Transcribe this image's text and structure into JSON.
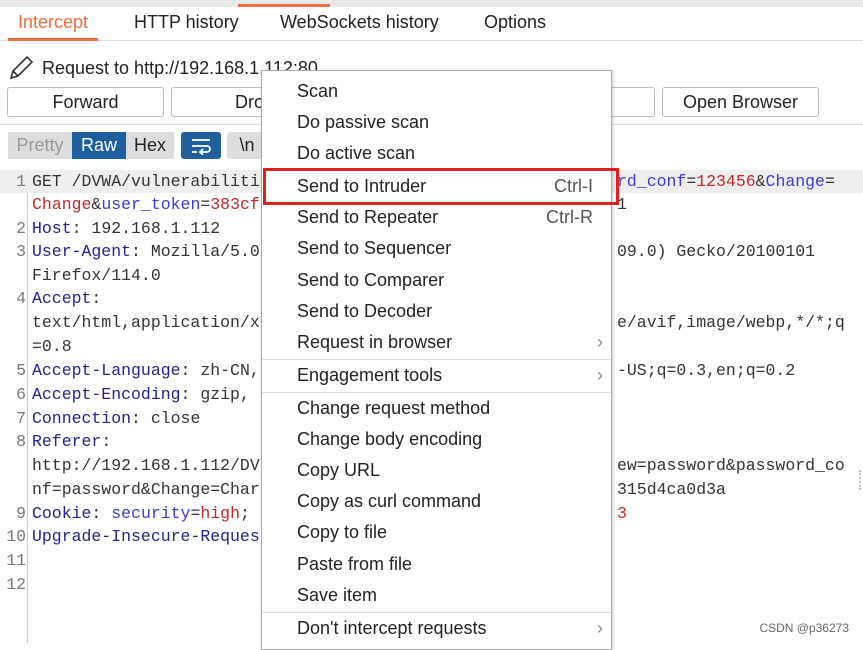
{
  "tabs": [
    "Intercept",
    "HTTP history",
    "WebSockets history",
    "Options"
  ],
  "request_label": "Request to http://192.168.1.112:80",
  "buttons": {
    "forward": "Forward",
    "drop": "Dro",
    "open_browser": "Open Browser"
  },
  "view_modes": [
    "Pretty",
    "Raw",
    "Hex"
  ],
  "newline_toggle": "\\n",
  "colors": {
    "accent": "#f26b3a",
    "selected": "#1f5f9e",
    "highlight_box": "#e02020"
  },
  "editor_rows": [
    {
      "n": "1",
      "hl": true,
      "l": [
        [
          "GET /DVWA/vulnerabiliti",
          "n"
        ]
      ],
      "r": [
        [
          "rd_conf",
          "p"
        ],
        [
          "=",
          "n"
        ],
        [
          "123456",
          "v"
        ],
        [
          "&",
          "n"
        ],
        [
          "Change",
          "p"
        ],
        [
          "=",
          "n"
        ]
      ]
    },
    {
      "n": "",
      "l": [
        [
          "Change",
          "v"
        ],
        [
          "&",
          "n"
        ],
        [
          "user_token",
          "p"
        ],
        [
          "=",
          "n"
        ],
        [
          "383cf",
          "v"
        ]
      ],
      "r": [
        [
          "1",
          "n"
        ]
      ]
    },
    {
      "n": "2",
      "l": [
        [
          "Host",
          "k"
        ],
        [
          ": 192.168.1.112",
          "n"
        ]
      ]
    },
    {
      "n": "3",
      "l": [
        [
          "User-Agent",
          "k"
        ],
        [
          ": Mozilla/5.0",
          "n"
        ]
      ],
      "r": [
        [
          "09.0) Gecko/20100101",
          "n"
        ]
      ]
    },
    {
      "n": "",
      "l": [
        [
          "Firefox/114.0",
          "n"
        ]
      ]
    },
    {
      "n": "4",
      "l": [
        [
          "Accept",
          "k"
        ],
        [
          ":",
          "n"
        ]
      ]
    },
    {
      "n": "",
      "l": [
        [
          "text/html,application/x",
          "n"
        ]
      ],
      "r": [
        [
          "e/avif,image/webp,*/*;q",
          "n"
        ]
      ]
    },
    {
      "n": "",
      "l": [
        [
          "=0.8",
          "n"
        ]
      ]
    },
    {
      "n": "5",
      "l": [
        [
          "Accept-Language",
          "k"
        ],
        [
          ": zh-CN,",
          "n"
        ]
      ],
      "r": [
        [
          "-US;q=0.3,en;q=0.2",
          "n"
        ]
      ]
    },
    {
      "n": "6",
      "l": [
        [
          "Accept-Encoding",
          "k"
        ],
        [
          ": gzip,",
          "n"
        ]
      ]
    },
    {
      "n": "7",
      "l": [
        [
          "Connection",
          "k"
        ],
        [
          ": close",
          "n"
        ]
      ]
    },
    {
      "n": "8",
      "l": [
        [
          "Referer",
          "k"
        ],
        [
          ":",
          "n"
        ]
      ]
    },
    {
      "n": "",
      "l": [
        [
          "http://192.168.1.112/DV",
          "n"
        ]
      ],
      "r": [
        [
          "ew=password&password_co",
          "n"
        ]
      ]
    },
    {
      "n": "",
      "l": [
        [
          "nf=password&Change=Char",
          "n"
        ]
      ],
      "r": [
        [
          "315d4ca0d3a",
          "n"
        ]
      ]
    },
    {
      "n": "9",
      "l": [
        [
          "Cookie",
          "k"
        ],
        [
          ": ",
          "n"
        ],
        [
          "security",
          "p"
        ],
        [
          "=",
          "n"
        ],
        [
          "high",
          "v"
        ],
        [
          ";",
          "n"
        ]
      ],
      "r": [
        [
          "3",
          "v"
        ]
      ]
    },
    {
      "n": "10",
      "l": [
        [
          "Upgrade-Insecure-Reques",
          "k"
        ]
      ]
    },
    {
      "n": "11",
      "l": []
    },
    {
      "n": "12",
      "l": []
    }
  ],
  "context_menu": [
    {
      "label": "Scan"
    },
    {
      "label": "Do passive scan"
    },
    {
      "label": "Do active scan"
    },
    {
      "label": "Send to Intruder",
      "shortcut": "Ctrl-I",
      "highlighted": true
    },
    {
      "label": "Send to Repeater",
      "shortcut": "Ctrl-R"
    },
    {
      "label": "Send to Sequencer"
    },
    {
      "label": "Send to Comparer"
    },
    {
      "label": "Send to Decoder"
    },
    {
      "label": "Request in browser",
      "submenu": true,
      "sep_after": true
    },
    {
      "label": "Engagement tools",
      "submenu": true,
      "sep_after": true
    },
    {
      "label": "Change request method"
    },
    {
      "label": "Change body encoding"
    },
    {
      "label": "Copy URL"
    },
    {
      "label": "Copy as curl command"
    },
    {
      "label": "Copy to file"
    },
    {
      "label": "Paste from file"
    },
    {
      "label": "Save item",
      "sep_after": true
    },
    {
      "label": "Don't intercept requests",
      "submenu": true
    }
  ],
  "watermark": "CSDN @p36273"
}
